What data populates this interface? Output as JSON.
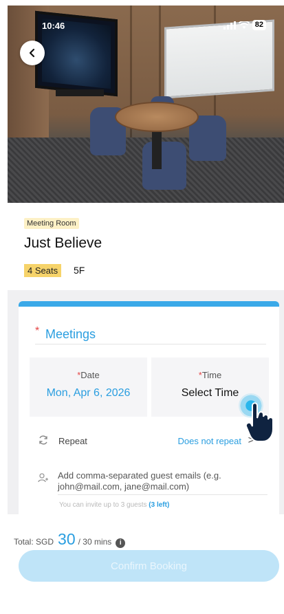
{
  "status_bar": {
    "time": "10:46",
    "signal_icon": "signal-bars-icon",
    "wifi_icon": "wifi-icon",
    "battery": "82"
  },
  "room": {
    "type": "Meeting Room",
    "name": "Just Believe",
    "seats": "4 Seats",
    "floor": "5F"
  },
  "form": {
    "title_required": "*",
    "title": "Meetings",
    "date": {
      "label_required": "*",
      "label": "Date",
      "value": "Mon, Apr 6, 2026"
    },
    "time": {
      "label_required": "*",
      "label": "Time",
      "value": "Select Time"
    },
    "repeat": {
      "label": "Repeat",
      "value": "Does not repeat",
      "chevron": ">"
    },
    "guests": {
      "placeholder": "Add comma-separated guest emails (e.g. john@mail.com, jane@mail.com)",
      "hint": "You can invite up to 3 guests",
      "remaining": "(3 left)"
    }
  },
  "footer": {
    "total_prefix": "Total: SGD",
    "total_amount": "30",
    "total_suffix": "/ 30 mins",
    "info_icon": "info-icon",
    "confirm_label": "Confirm Booking"
  },
  "colors": {
    "accent": "#2a9ee0",
    "card_top": "#3aa9e8",
    "seats_badge": "#f6d36a",
    "confirm_disabled": "#bfe4f8"
  }
}
